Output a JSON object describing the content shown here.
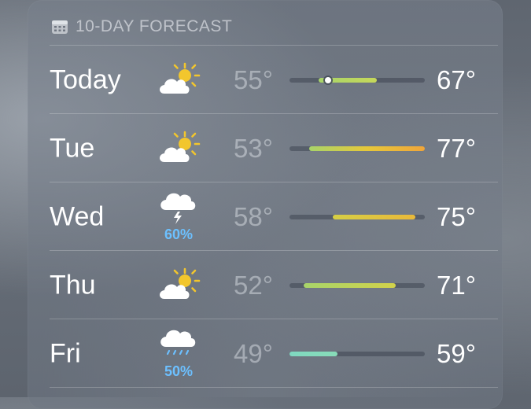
{
  "header": {
    "title": "10-DAY FORECAST",
    "icon": "calendar-icon"
  },
  "colors": {
    "fill_green": "#a8d46a",
    "fill_yellow": "#e6c83a",
    "fill_orange": "#f0a53a",
    "fill_mint": "#7fd8c0",
    "precip_blue": "#6cc0ff"
  },
  "range": {
    "min": 49,
    "max": 77
  },
  "days": [
    {
      "day": "Today",
      "icon": "partly-sunny-icon",
      "precip": "",
      "low": "55°",
      "high": "67°",
      "low_value": 55,
      "high_value": 67,
      "current_value": 57,
      "colors": [
        "#a8d46a",
        "#c6d85a"
      ]
    },
    {
      "day": "Tue",
      "icon": "partly-sunny-icon",
      "precip": "",
      "low": "53°",
      "high": "77°",
      "low_value": 53,
      "high_value": 77,
      "current_value": null,
      "colors": [
        "#a8d46a",
        "#e6c83a",
        "#f0a53a"
      ]
    },
    {
      "day": "Wed",
      "icon": "thunderstorm-icon",
      "precip": "60%",
      "low": "58°",
      "high": "75°",
      "low_value": 58,
      "high_value": 75,
      "current_value": null,
      "colors": [
        "#d6cf45",
        "#e9b93a"
      ]
    },
    {
      "day": "Thu",
      "icon": "partly-sunny-icon",
      "precip": "",
      "low": "52°",
      "high": "71°",
      "low_value": 52,
      "high_value": 71,
      "current_value": null,
      "colors": [
        "#a8d46a",
        "#d2d24a"
      ]
    },
    {
      "day": "Fri",
      "icon": "rain-cloud-icon",
      "precip": "50%",
      "low": "49°",
      "high": "59°",
      "low_value": 49,
      "high_value": 59,
      "current_value": null,
      "colors": [
        "#7fd8c0",
        "#88dcb8"
      ]
    }
  ]
}
